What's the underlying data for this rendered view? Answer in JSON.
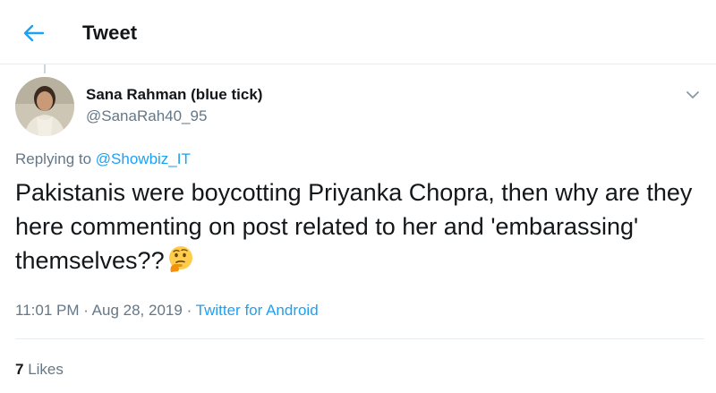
{
  "header": {
    "title": "Tweet",
    "back_icon": "arrow-left-icon"
  },
  "author": {
    "name": "Sana Rahman (blue tick)",
    "handle": "@SanaRah40_95",
    "avatar_icon": "profile-photo"
  },
  "tweet": {
    "replying_prefix": "Replying to",
    "replying_handle": "@Showbiz_IT",
    "text": "Pakistanis were boycotting Priyanka Chopra, then why are they here commenting on post related to her and 'embarassing' themselves??",
    "emoji": "thinking-face-icon",
    "time_date": "11:01 PM · Aug 28, 2019",
    "separator": "·",
    "source": "Twitter for Android"
  },
  "stats": {
    "likes_count": "7",
    "likes_label": "Likes"
  },
  "colors": {
    "accent": "#1da1f2",
    "secondary_text": "#657786",
    "primary_text": "#14171a",
    "divider": "#e6ecf0"
  }
}
